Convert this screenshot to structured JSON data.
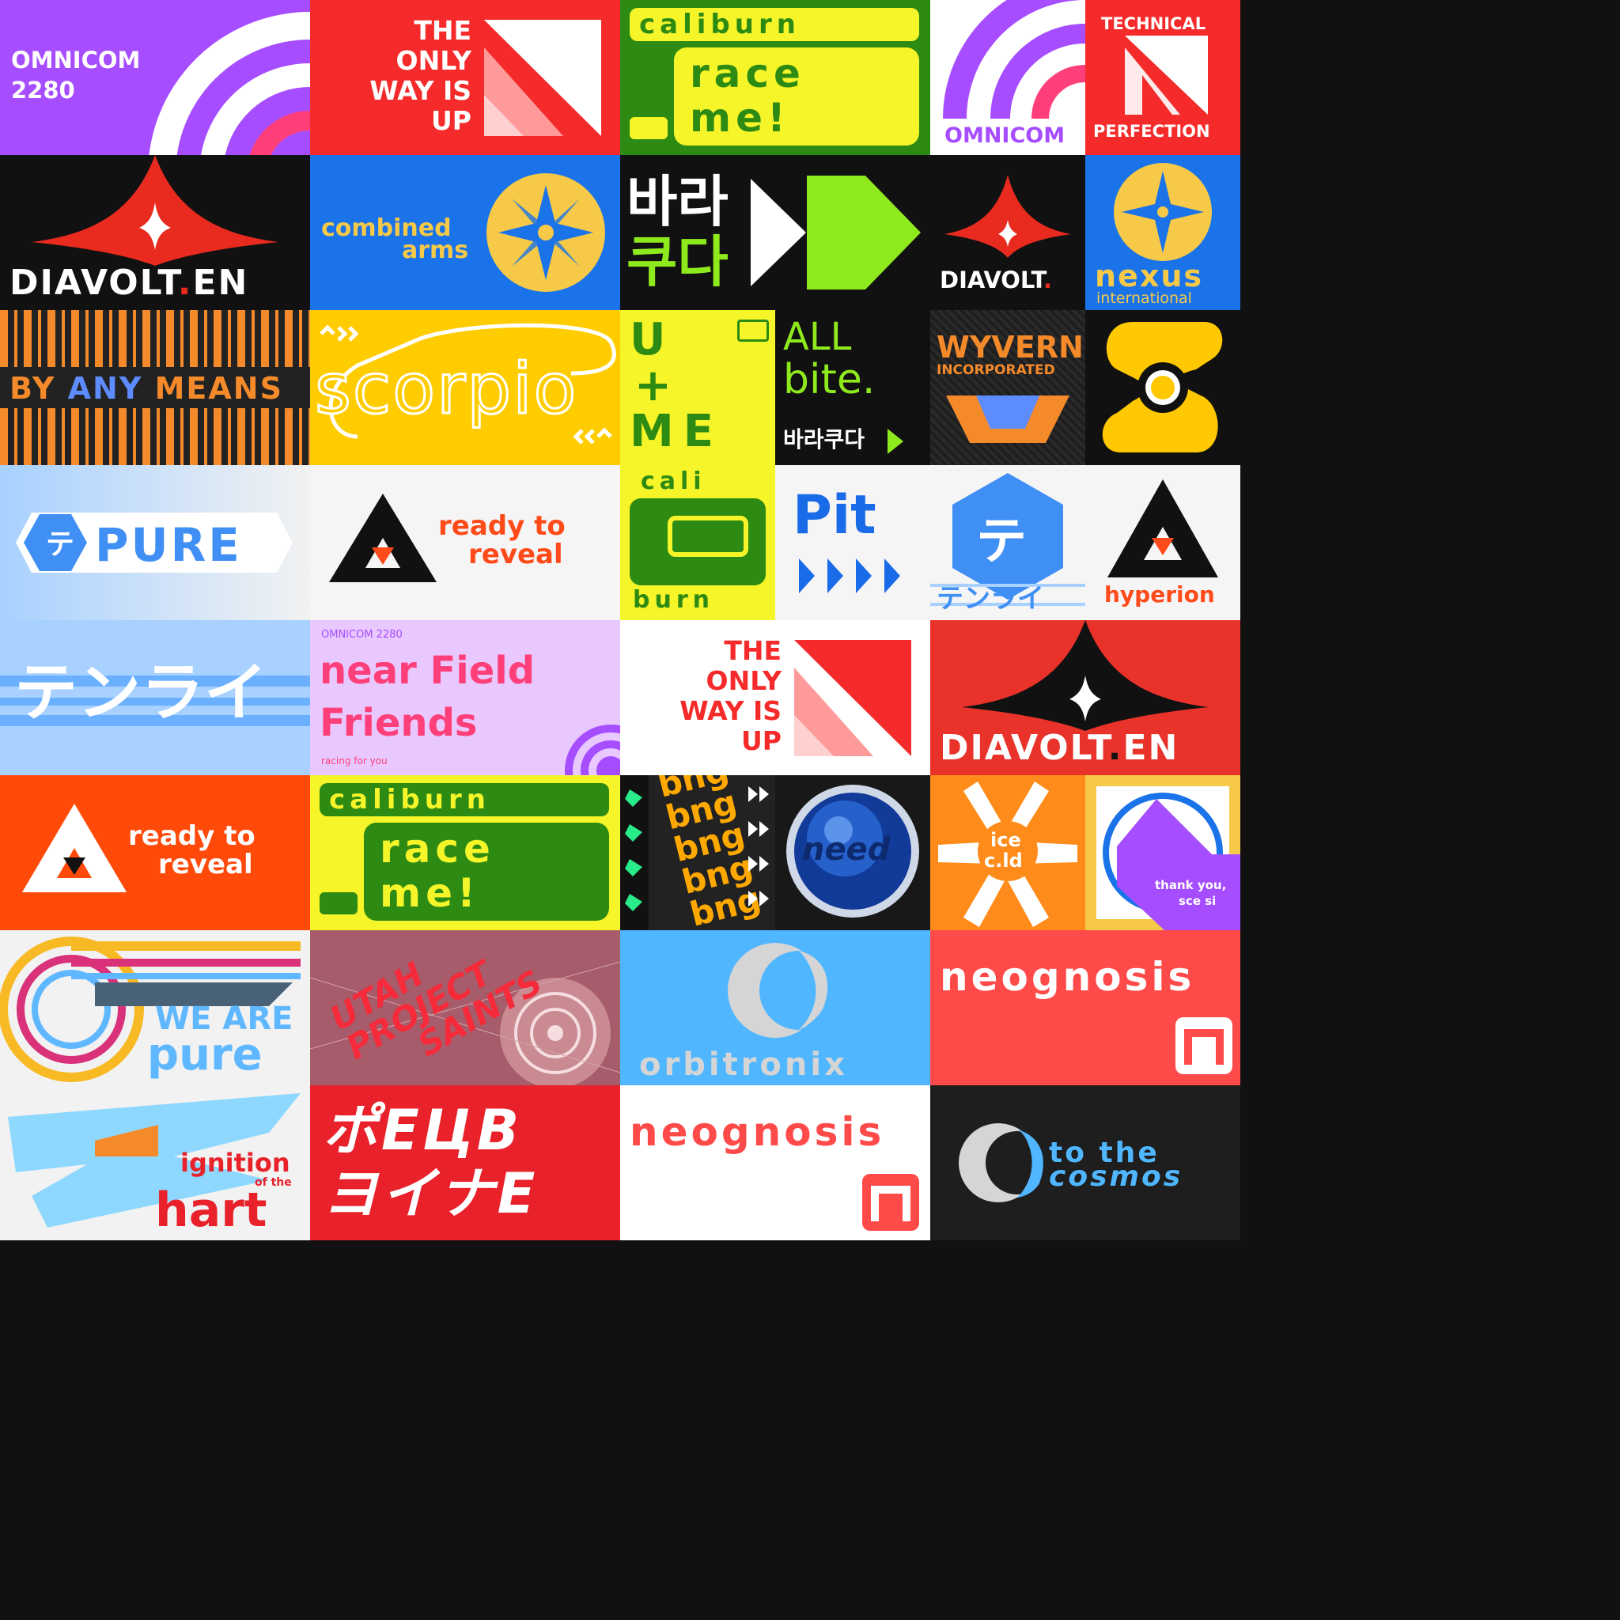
{
  "tiles": {
    "omnicom2280": {
      "name": "OMNICOM",
      "year": "2280"
    },
    "onlyway1": {
      "l1": "THE",
      "l2": "ONLY",
      "l3": "WAY IS",
      "l4": "UP"
    },
    "caliburn1": {
      "brand": "caliburn",
      "l1": "race",
      "l2": "me!"
    },
    "omnicom": {
      "name": "OMNICOM"
    },
    "technical": {
      "top": "TECHNICAL",
      "bottom": "PERFECTION"
    },
    "diavolt1": {
      "name": "DIAVOLT",
      "suffix": "EN"
    },
    "combined": {
      "l1": "combined",
      "l2": "arms"
    },
    "barracuda": {
      "l1": "바라",
      "l2": "쿠다"
    },
    "diavolt2": {
      "name": "DIAVOLT",
      "dot": "."
    },
    "nexus": {
      "name": "nexus",
      "sub": "international"
    },
    "anymeans": {
      "w1": "BY",
      "w2": "ANY",
      "w3": "MEANS"
    },
    "scorpio": {
      "name": "scorpio"
    },
    "ume": {
      "l1": "U",
      "l2": "+",
      "l3": "ME"
    },
    "allbite": {
      "l1": "ALL",
      "l2": "bite.",
      "sub": "바라쿠다"
    },
    "wyvern": {
      "name": "WYVERN",
      "sub": "INCORPORATED"
    },
    "pure": {
      "name": "PURE"
    },
    "reveal1": {
      "l1": "ready to",
      "l2": "reveal"
    },
    "cali": {
      "top": "cali",
      "bottom": "burn"
    },
    "pit": {
      "name": "Pit"
    },
    "tenrai1": {
      "name": "テンライ"
    },
    "hyperion": {
      "name": "hyperion"
    },
    "tenrai2": {
      "name": "テンライ"
    },
    "nearfield": {
      "top": "OMNICOM 2280",
      "l1": "near Field",
      "l2": "Friends",
      "sub": "racing for you"
    },
    "onlyway2": {
      "l1": "THE",
      "l2": "ONLY",
      "l3": "WAY IS",
      "l4": "UP"
    },
    "diavolt3": {
      "name": "DIAVOLT",
      "suffix": "EN"
    },
    "reveal2": {
      "l1": "ready to",
      "l2": "reveal"
    },
    "caliburn2": {
      "brand": "caliburn",
      "l1": "race",
      "l2": "me!"
    },
    "bng": {
      "word": "bng"
    },
    "need": {
      "name": "need"
    },
    "icecold": {
      "l1": "ice",
      "l2": "c.ld"
    },
    "thankyou": {
      "l1": "thank you,",
      "l2": "sce si"
    },
    "wearepure": {
      "l1": "WE ARE",
      "l2": "pure"
    },
    "utah": {
      "l1": "UTAH",
      "l2": "PROJECT",
      "l3": "SAINTS"
    },
    "orbitronix": {
      "name": "orbitronix"
    },
    "neognosis1": {
      "name": "neognosis"
    },
    "ignition": {
      "l1": "ignition",
      "l2": "of the",
      "l3": "hart"
    },
    "megabyte": {
      "l1": "ポEЦB",
      "l2": "ヨイナE"
    },
    "neognosis2": {
      "name": "neognosis"
    },
    "cosmos": {
      "l1": "to the",
      "l2": "cosmos"
    }
  }
}
